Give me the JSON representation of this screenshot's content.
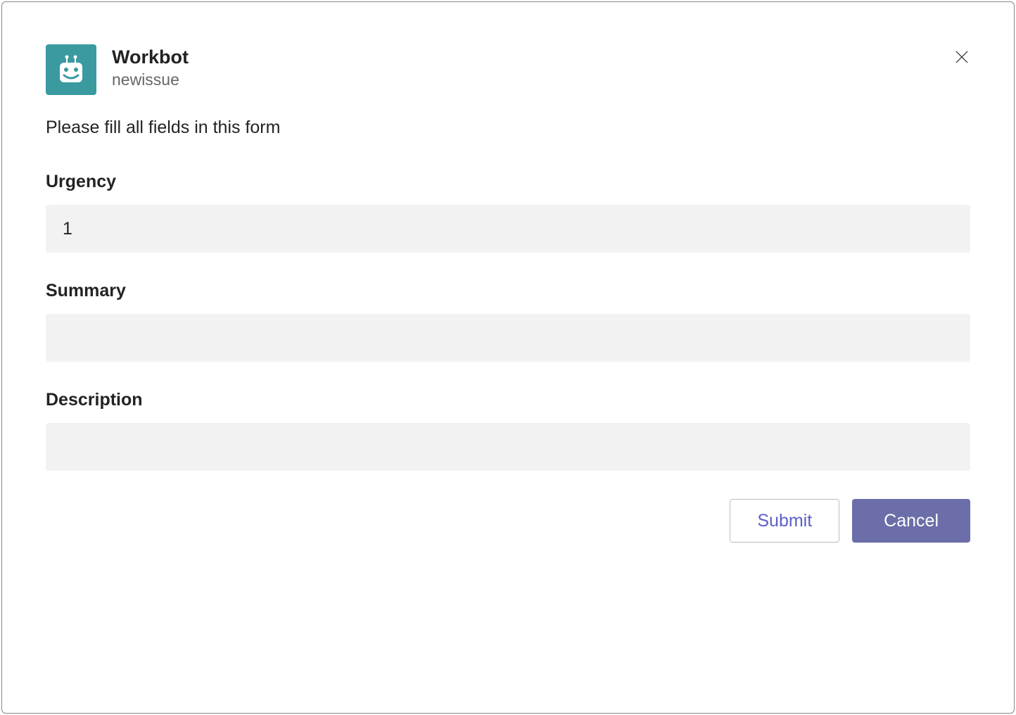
{
  "header": {
    "title": "Workbot",
    "subtitle": "newissue"
  },
  "instruction": "Please fill all fields in this form",
  "fields": {
    "urgency": {
      "label": "Urgency",
      "value": "1"
    },
    "summary": {
      "label": "Summary",
      "value": ""
    },
    "description": {
      "label": "Description",
      "value": ""
    }
  },
  "buttons": {
    "submit": "Submit",
    "cancel": "Cancel"
  }
}
